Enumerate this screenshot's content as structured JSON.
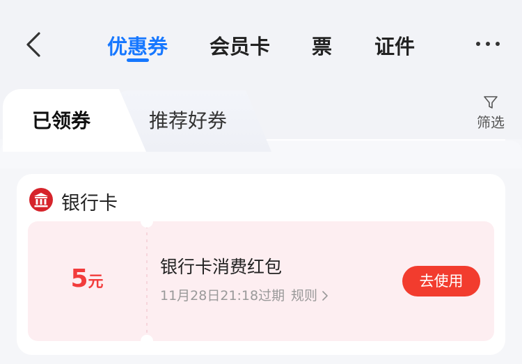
{
  "nav": {
    "tabs": [
      {
        "label": "优惠券",
        "active": true
      },
      {
        "label": "会员卡",
        "active": false
      },
      {
        "label": "票",
        "active": false
      },
      {
        "label": "证件",
        "active": false
      }
    ],
    "back_icon": "chevron-left-icon",
    "more_icon": "more-horizontal-icon",
    "accent_color": "#1677ff"
  },
  "subtabs": {
    "items": [
      {
        "label": "已领券",
        "active": true
      },
      {
        "label": "推荐好券",
        "active": false
      }
    ],
    "filter_label": "筛选",
    "filter_icon": "filter-icon"
  },
  "section": {
    "title": "银行卡",
    "icon": "bank-icon",
    "coupon": {
      "amount": "5",
      "unit": "元",
      "title": "银行卡消费红包",
      "expiry": "11月28日21:18过期",
      "rules_label": "规则",
      "use_button": "去使用",
      "accent_color": "#f23c2e",
      "background_color": "#fdeef1"
    }
  }
}
